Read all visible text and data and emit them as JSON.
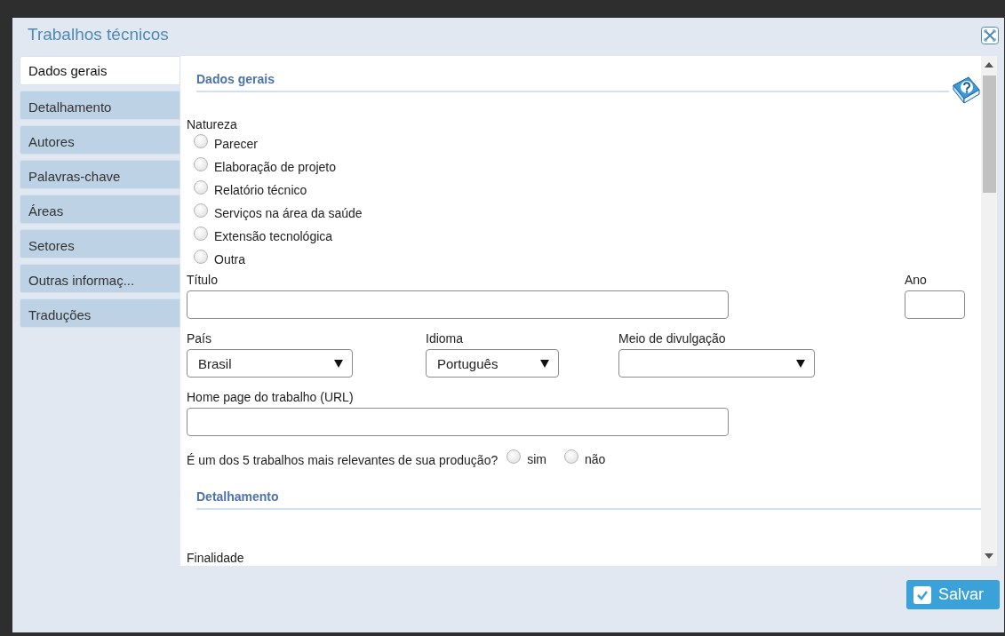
{
  "window": {
    "title": "Trabalhos técnicos"
  },
  "tabs": [
    {
      "label": "Dados gerais",
      "selected": true
    },
    {
      "label": "Detalhamento",
      "selected": false
    },
    {
      "label": "Autores",
      "selected": false
    },
    {
      "label": "Palavras-chave",
      "selected": false
    },
    {
      "label": "Áreas",
      "selected": false
    },
    {
      "label": "Setores",
      "selected": false
    },
    {
      "label": "Outras informaç...",
      "selected": false
    },
    {
      "label": "Traduções",
      "selected": false
    }
  ],
  "form": {
    "section_title": "Dados gerais",
    "natureza": {
      "label": "Natureza",
      "options": [
        {
          "label": "Parecer",
          "selected": false
        },
        {
          "label": "Elaboração de projeto",
          "selected": false
        },
        {
          "label": "Relatório técnico",
          "selected": false
        },
        {
          "label": "Serviços na área da saúde",
          "selected": false
        },
        {
          "label": "Extensão tecnológica",
          "selected": false
        },
        {
          "label": "Outra",
          "selected": false
        }
      ]
    },
    "titulo": {
      "label": "Título"
    },
    "ano": {
      "label": "Ano"
    },
    "pais": {
      "label": "País",
      "value": "Brasil"
    },
    "idioma": {
      "label": "Idioma",
      "value": "Português"
    },
    "meio": {
      "label": "Meio de divulgação"
    },
    "url": {
      "label": "Home page do trabalho (URL)"
    },
    "relevante": {
      "question": "É um dos 5 trabalhos mais relevantes de sua produção?",
      "options": [
        {
          "label": "sim",
          "selected": false
        },
        {
          "label": "não",
          "selected": false
        }
      ]
    },
    "section2_title": "Detalhamento",
    "finalidade": {
      "label": "Finalidade"
    }
  },
  "buttons": [
    {
      "label": "Salvar"
    }
  ]
}
